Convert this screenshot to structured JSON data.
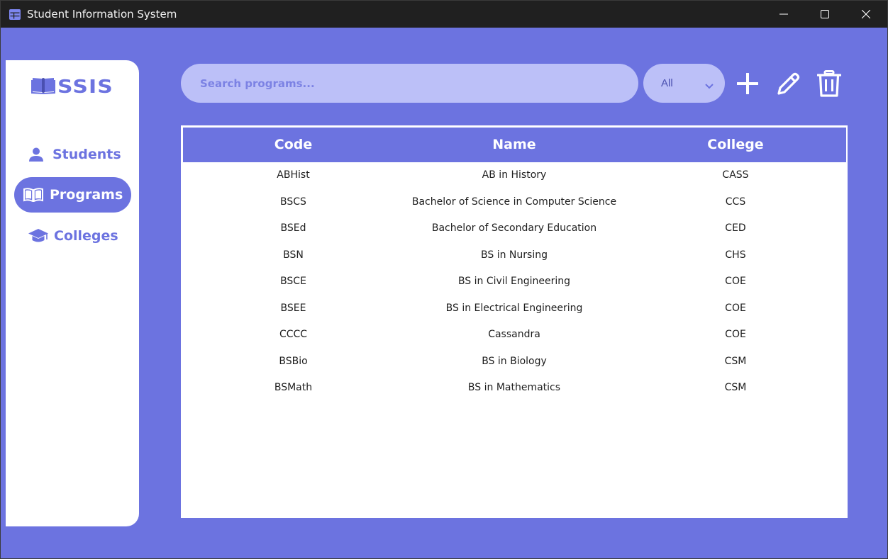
{
  "window": {
    "title": "Student Information System"
  },
  "colors": {
    "accent": "#6c73e0",
    "light_accent": "#bcc0f8",
    "titlebar": "#202020"
  },
  "sidebar": {
    "logo_text": "SSIS",
    "items": [
      {
        "label": "Students",
        "icon": "user-icon",
        "active": false
      },
      {
        "label": "Programs",
        "icon": "open-book-icon",
        "active": true
      },
      {
        "label": "Colleges",
        "icon": "graduation-cap-icon",
        "active": false
      }
    ]
  },
  "toolbar": {
    "search_placeholder": "Search programs...",
    "filter_value": "All",
    "add_icon": "plus-icon",
    "edit_icon": "pencil-icon",
    "delete_icon": "trash-icon"
  },
  "table": {
    "columns": [
      "Code",
      "Name",
      "College"
    ],
    "rows": [
      [
        "ABHist",
        "AB in History",
        "CASS"
      ],
      [
        "BSCS",
        "Bachelor of Science in Computer Science",
        "CCS"
      ],
      [
        "BSEd",
        "Bachelor of Secondary Education",
        "CED"
      ],
      [
        "BSN",
        "BS in Nursing",
        "CHS"
      ],
      [
        "BSCE",
        "BS in Civil Engineering",
        "COE"
      ],
      [
        "BSEE",
        "BS in Electrical Engineering",
        "COE"
      ],
      [
        "CCCC",
        "Cassandra",
        "COE"
      ],
      [
        "BSBio",
        "BS in Biology",
        "CSM"
      ],
      [
        "BSMath",
        "BS in Mathematics",
        "CSM"
      ]
    ]
  }
}
